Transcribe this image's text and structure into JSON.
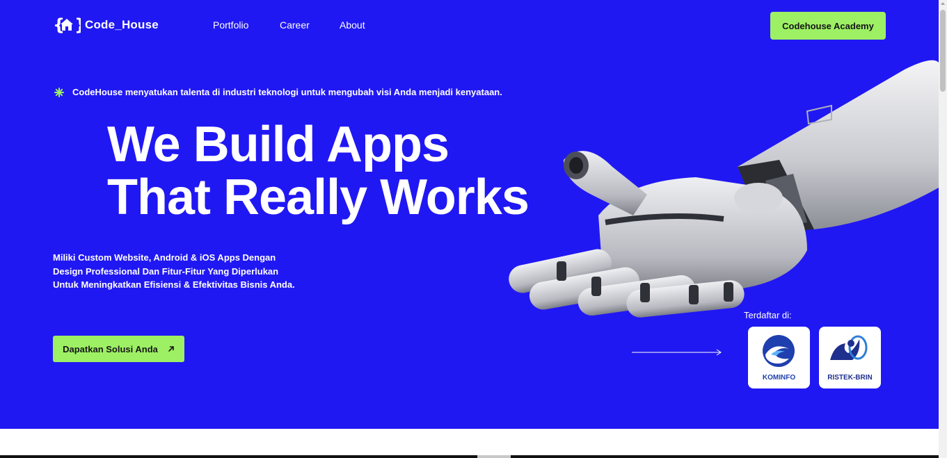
{
  "header": {
    "logo_text": "Code_House",
    "nav": [
      {
        "label": "Portfolio"
      },
      {
        "label": "Career"
      },
      {
        "label": "About"
      }
    ],
    "academy_button": "Codehouse Academy"
  },
  "hero": {
    "tagline": "CodeHouse menyatukan talenta di industri teknologi untuk mengubah visi Anda menjadi kenyataan.",
    "headline_line1": "We Build Apps",
    "headline_line2": "That Really Works",
    "subtext_line1": "Miliki Custom Website, Android & iOS Apps Dengan",
    "subtext_line2": "Design Professional Dan Fitur-Fitur Yang Diperlukan",
    "subtext_line3": "Untuk Meningkatkan Efisiensi & Efektivitas Bisnis Anda.",
    "cta_label": "Dapatkan Solusi Anda",
    "registered_label": "Terdaftar di:",
    "badges": [
      {
        "label": "KOMINFO",
        "icon": "kominfo-logo"
      },
      {
        "label": "RISTEK-BRIN",
        "icon": "ristek-brin-logo"
      }
    ]
  },
  "colors": {
    "hero_bg": "#2018f2",
    "accent": "#9df064"
  }
}
